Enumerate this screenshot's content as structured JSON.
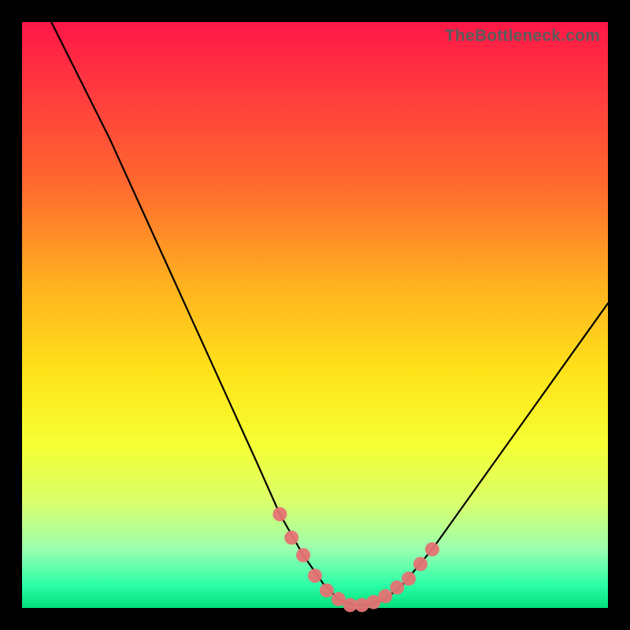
{
  "watermark": "TheBottleneck.com",
  "chart_data": {
    "type": "line",
    "title": "",
    "xlabel": "",
    "ylabel": "",
    "xlim": [
      0,
      100
    ],
    "ylim": [
      0,
      100
    ],
    "grid": false,
    "legend": false,
    "series": [
      {
        "name": "bottleneck-curve",
        "x": [
          5,
          10,
          15,
          20,
          25,
          30,
          35,
          40,
          44,
          48,
          51.5,
          54,
          56.5,
          59,
          62,
          65,
          70,
          75,
          80,
          85,
          90,
          95,
          100
        ],
        "y": [
          100,
          90,
          80,
          69,
          58,
          47,
          36,
          25,
          16,
          9,
          4,
          1.5,
          0.5,
          0.5,
          1.5,
          4,
          10,
          17,
          24,
          31,
          38,
          45,
          52
        ]
      }
    ],
    "markers": {
      "name": "highlight-dots",
      "x": [
        44,
        46,
        48,
        50,
        52,
        54,
        56,
        58,
        60,
        62,
        64,
        66,
        68,
        70
      ],
      "y": [
        16,
        12,
        9,
        5.5,
        3,
        1.5,
        0.5,
        0.5,
        1,
        2,
        3.5,
        5,
        7.5,
        10
      ]
    },
    "gradient_stops": [
      {
        "pos": 0.0,
        "color": "#ff1747"
      },
      {
        "pos": 0.12,
        "color": "#ff3b3f"
      },
      {
        "pos": 0.28,
        "color": "#ff6a2e"
      },
      {
        "pos": 0.45,
        "color": "#ffb21f"
      },
      {
        "pos": 0.6,
        "color": "#ffe31a"
      },
      {
        "pos": 0.72,
        "color": "#f5ff33"
      },
      {
        "pos": 0.82,
        "color": "#d9ff6b"
      },
      {
        "pos": 0.9,
        "color": "#9bffb0"
      },
      {
        "pos": 0.96,
        "color": "#2dffa8"
      },
      {
        "pos": 1.0,
        "color": "#00e07a"
      }
    ]
  }
}
